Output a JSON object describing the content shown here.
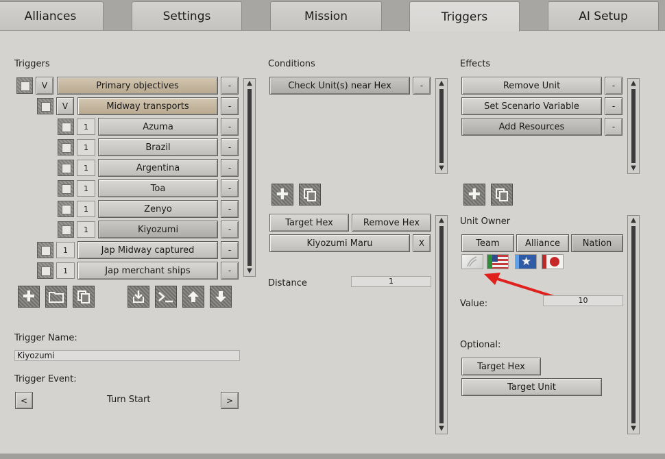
{
  "tabs": [
    "Alliances",
    "Settings",
    "Mission",
    "Triggers",
    "AI Setup"
  ],
  "active_tab": "Triggers",
  "triggers": {
    "heading": "Triggers",
    "items": [
      {
        "toggle": "V",
        "label": "Primary objectives",
        "remove": "-"
      },
      {
        "toggle": "V",
        "label": "Midway transports",
        "remove": "-"
      },
      {
        "toggle": "1",
        "label": "Azuma",
        "remove": "-"
      },
      {
        "toggle": "1",
        "label": "Brazil",
        "remove": "-"
      },
      {
        "toggle": "1",
        "label": "Argentina",
        "remove": "-"
      },
      {
        "toggle": "1",
        "label": "Toa",
        "remove": "-"
      },
      {
        "toggle": "1",
        "label": "Zenyo",
        "remove": "-"
      },
      {
        "toggle": "1",
        "label": "Kiyozumi",
        "remove": "-"
      },
      {
        "toggle": "1",
        "label": "Jap Midway captured",
        "remove": "-"
      },
      {
        "toggle": "1",
        "label": "Jap merchant ships",
        "remove": "-"
      }
    ],
    "toolbar_icons": [
      "add-icon",
      "folder-icon",
      "copy-icon",
      "import-icon",
      "console-icon",
      "move-up-icon",
      "move-down-icon"
    ],
    "name_label": "Trigger Name:",
    "name_value": "Kiyozumi",
    "event_label": "Trigger Event:",
    "event_prev": "<",
    "event_value": "Turn Start",
    "event_next": ">"
  },
  "conditions": {
    "heading": "Conditions",
    "items": [
      {
        "label": "Check Unit(s) near Hex",
        "remove": "-"
      }
    ],
    "target_hex": "Target Hex",
    "remove_hex": "Remove Hex",
    "unit_name": "Kiyozumi Maru",
    "unit_clear": "X",
    "distance_label": "Distance",
    "distance_value": "1"
  },
  "effects": {
    "heading": "Effects",
    "items": [
      {
        "label": "Remove Unit",
        "remove": "-"
      },
      {
        "label": "Set Scenario Variable",
        "remove": "-"
      },
      {
        "label": "Add Resources",
        "remove": "-"
      }
    ],
    "owner_label": "Unit Owner",
    "owner_modes": [
      "Team",
      "Alliance",
      "Nation"
    ],
    "flags": [
      "unassigned-flag-icon",
      "us-flag-icon",
      "star-flag-icon",
      "japan-flag-icon"
    ],
    "value_label": "Value:",
    "value": "10",
    "optional_label": "Optional:",
    "target_hex": "Target Hex",
    "target_unit": "Target Unit"
  },
  "colors": {
    "annotation_arrow": "#e0201c",
    "tan_button": "#c6b89f"
  }
}
